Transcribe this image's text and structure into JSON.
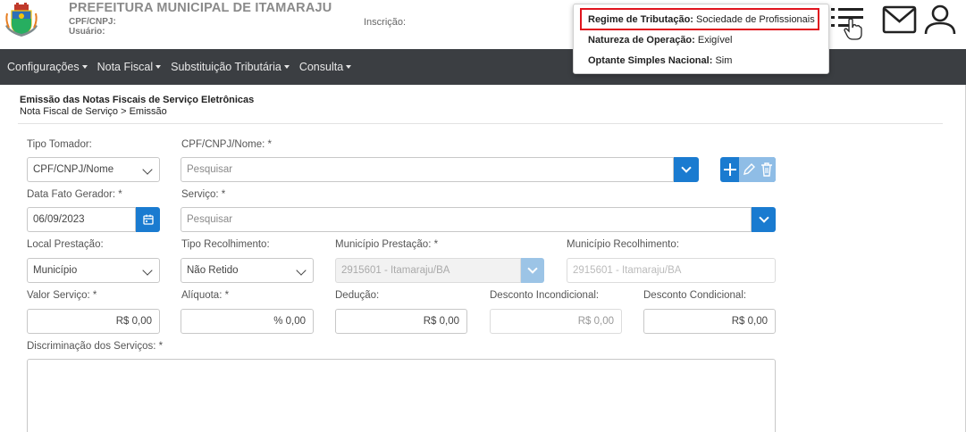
{
  "header": {
    "org_name": "PREFEITURA MUNICIPAL DE ITAMARAJU",
    "cpf_cnpj_label": "CPF/CNPJ:",
    "usuario_label": "Usuário:",
    "inscricao_label": "Inscrição:",
    "icons": [
      "coat-of-arms-logo",
      "list-menu-icon",
      "pointer-hand-icon",
      "envelope-icon",
      "user-icon"
    ]
  },
  "nav": {
    "items": [
      {
        "label": "Configurações"
      },
      {
        "label": "Nota Fiscal"
      },
      {
        "label": "Substituição Tributária"
      },
      {
        "label": "Consulta"
      }
    ]
  },
  "page": {
    "title": "Emissão das Notas Fiscais de Serviço Eletrônicas",
    "breadcrumb": "Nota Fiscal de Serviço > Emissão"
  },
  "popup": {
    "regime_label": "Regime de Tributação:",
    "regime_value": "Sociedade de Profissionais",
    "natureza_label": "Natureza de Operação:",
    "natureza_value": "Exigível",
    "optante_label": "Optante Simples Nacional:",
    "optante_value": "Sim",
    "highlight_color": "#e0141e"
  },
  "form": {
    "tipo_tomador": {
      "label": "Tipo Tomador:",
      "value": "CPF/CNPJ/Nome"
    },
    "cpf_cnpj_nome": {
      "label": "CPF/CNPJ/Nome: *",
      "placeholder": "Pesquisar"
    },
    "data_fato": {
      "label": "Data Fato Gerador: *",
      "value": "06/09/2023"
    },
    "servico": {
      "label": "Serviço: *",
      "placeholder": "Pesquisar"
    },
    "local_prestacao": {
      "label": "Local Prestação:",
      "value": "Município"
    },
    "tipo_recolhimento": {
      "label": "Tipo Recolhimento:",
      "value": "Não Retido"
    },
    "municipio_prestacao": {
      "label": "Município Prestação: *",
      "value": "2915601 - Itamaraju/BA"
    },
    "municipio_recolhimento": {
      "label": "Município Recolhimento:",
      "value": "2915601 - Itamaraju/BA"
    },
    "valor_servico": {
      "label": "Valor Serviço: *",
      "value": "R$ 0,00"
    },
    "aliquota": {
      "label": "Alíquota: *",
      "value": "% 0,00"
    },
    "deducao": {
      "label": "Dedução:",
      "value": "R$ 0,00"
    },
    "desconto_incondicional": {
      "label": "Desconto Incondicional:",
      "value": "R$ 0,00"
    },
    "desconto_condicional": {
      "label": "Desconto Condicional:",
      "value": "R$ 0,00"
    },
    "discriminacao": {
      "label": "Discriminação dos Serviços: *"
    }
  },
  "colors": {
    "primary_blue": "#1a7bd0",
    "navbar_bg": "#3b3e42"
  }
}
